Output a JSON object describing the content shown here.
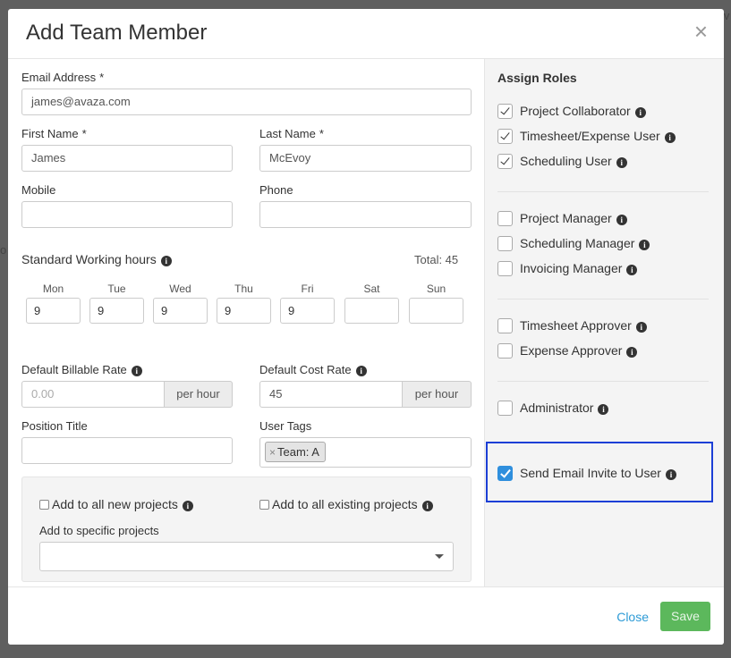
{
  "backdrop": {
    "corner_text": "iv",
    "left_edge_text": "o"
  },
  "modal": {
    "title": "Add Team Member",
    "close_glyph": "×"
  },
  "form": {
    "email": {
      "label": "Email Address",
      "required_mark": "*",
      "value": "james@avaza.com"
    },
    "first_name": {
      "label": "First Name",
      "required_mark": "*",
      "value": "James"
    },
    "last_name": {
      "label": "Last Name",
      "required_mark": "*",
      "value": "McEvoy"
    },
    "mobile": {
      "label": "Mobile",
      "value": ""
    },
    "phone": {
      "label": "Phone",
      "value": ""
    },
    "working_hours": {
      "label": "Standard Working hours",
      "total_label": "Total: 45",
      "days": [
        {
          "label": "Mon",
          "value": "9"
        },
        {
          "label": "Tue",
          "value": "9"
        },
        {
          "label": "Wed",
          "value": "9"
        },
        {
          "label": "Thu",
          "value": "9"
        },
        {
          "label": "Fri",
          "value": "9"
        },
        {
          "label": "Sat",
          "value": ""
        },
        {
          "label": "Sun",
          "value": ""
        }
      ]
    },
    "billable_rate": {
      "label": "Default Billable Rate",
      "placeholder": "0.00",
      "addon": "per hour"
    },
    "cost_rate": {
      "label": "Default Cost Rate",
      "value": "45",
      "addon": "per hour"
    },
    "position_title": {
      "label": "Position Title",
      "value": ""
    },
    "user_tags": {
      "label": "User Tags",
      "tags": [
        "Team: A"
      ],
      "remove_glyph": "×"
    },
    "projects": {
      "add_all_new": "Add to all new projects",
      "add_all_existing": "Add to all existing projects",
      "specific_label": "Add to specific projects"
    }
  },
  "roles": {
    "title": "Assign Roles",
    "group1": [
      {
        "label": "Project Collaborator",
        "checked": true
      },
      {
        "label": "Timesheet/Expense User",
        "checked": true
      },
      {
        "label": "Scheduling User",
        "checked": true
      }
    ],
    "group2": [
      {
        "label": "Project Manager",
        "checked": false
      },
      {
        "label": "Scheduling Manager",
        "checked": false
      },
      {
        "label": "Invoicing Manager",
        "checked": false
      }
    ],
    "group3": [
      {
        "label": "Timesheet Approver",
        "checked": false
      },
      {
        "label": "Expense Approver",
        "checked": false
      }
    ],
    "group4": [
      {
        "label": "Administrator",
        "checked": false
      }
    ],
    "send_invite": {
      "label": "Send Email Invite to User",
      "checked": true
    }
  },
  "footer": {
    "close_label": "Close",
    "save_label": "Save"
  },
  "colors": {
    "accent_blue": "#2d9bd6",
    "save_green": "#5cb85c",
    "highlight_border": "#1c3fd6"
  },
  "icons": {
    "info": "info-icon",
    "close": "close-icon",
    "caret": "chevron-down-icon"
  }
}
